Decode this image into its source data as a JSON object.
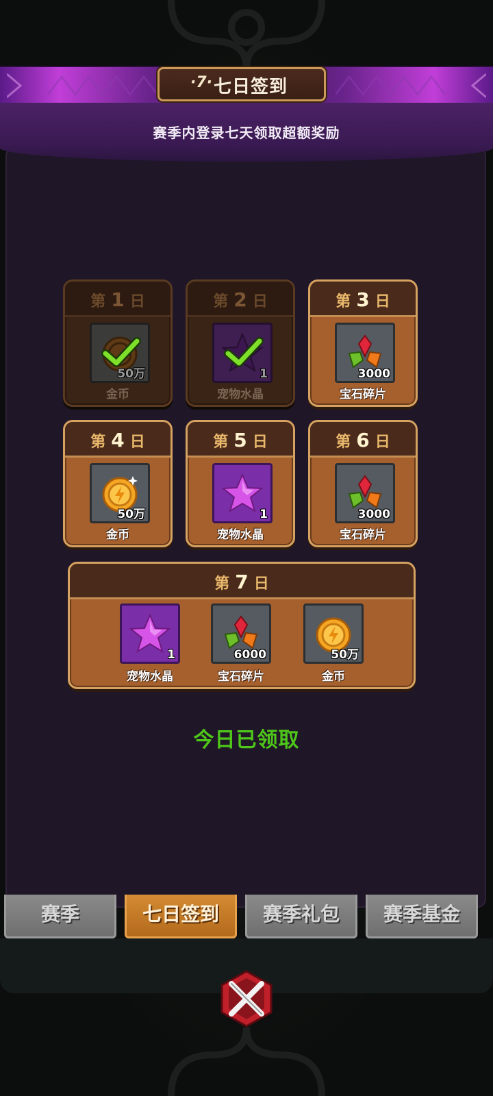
{
  "header": {
    "badge": "·7·",
    "title": "七日签到",
    "subtitle": "赛季内登录七天领取超额奖励"
  },
  "days": [
    {
      "prefix": "第",
      "num": "1",
      "suffix": "日",
      "claimed": true,
      "reward": {
        "icon": "gold-coin-icon",
        "qty": "50万",
        "name": "金币"
      }
    },
    {
      "prefix": "第",
      "num": "2",
      "suffix": "日",
      "claimed": true,
      "reward": {
        "icon": "pet-crystal-icon",
        "qty": "1",
        "name": "宠物水晶"
      }
    },
    {
      "prefix": "第",
      "num": "3",
      "suffix": "日",
      "claimed": false,
      "reward": {
        "icon": "gem-shard-icon",
        "qty": "3000",
        "name": "宝石碎片"
      }
    },
    {
      "prefix": "第",
      "num": "4",
      "suffix": "日",
      "claimed": false,
      "reward": {
        "icon": "gold-coin-icon",
        "qty": "50万",
        "name": "金币"
      }
    },
    {
      "prefix": "第",
      "num": "5",
      "suffix": "日",
      "claimed": false,
      "reward": {
        "icon": "pet-crystal-icon",
        "qty": "1",
        "name": "宠物水晶"
      }
    },
    {
      "prefix": "第",
      "num": "6",
      "suffix": "日",
      "claimed": false,
      "reward": {
        "icon": "gem-shard-icon",
        "qty": "3000",
        "name": "宝石碎片"
      }
    }
  ],
  "day7": {
    "prefix": "第",
    "num": "7",
    "suffix": "日",
    "rewards": [
      {
        "icon": "pet-crystal-icon",
        "qty": "1",
        "name": "宠物水晶"
      },
      {
        "icon": "gem-shard-icon",
        "qty": "6000",
        "name": "宝石碎片"
      },
      {
        "icon": "gold-coin-icon",
        "qty": "50万",
        "name": "金币"
      }
    ]
  },
  "status": "今日已领取",
  "tabs": [
    {
      "label": "赛季",
      "active": false
    },
    {
      "label": "七日签到",
      "active": true
    },
    {
      "label": "赛季礼包",
      "active": false
    },
    {
      "label": "赛季基金",
      "active": false
    }
  ],
  "colors": {
    "status_green": "#4ec71a",
    "tab_active": "#d48b33",
    "card_brown": "#a5602e",
    "banner_purple": "#c13ed8"
  }
}
